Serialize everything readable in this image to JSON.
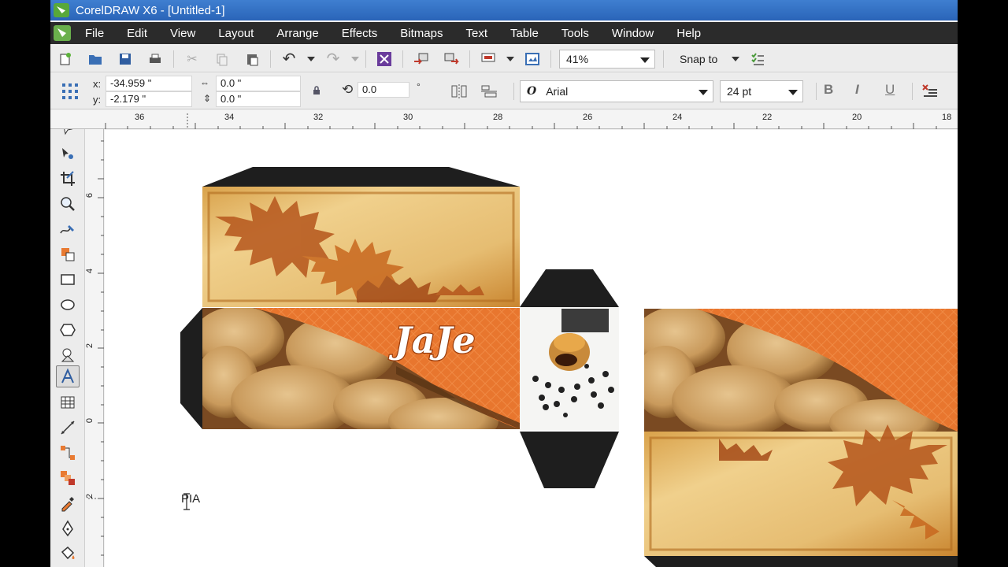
{
  "window": {
    "title": "CorelDRAW X6 - [Untitled-1]"
  },
  "menu": [
    "File",
    "Edit",
    "View",
    "Layout",
    "Arrange",
    "Effects",
    "Bitmaps",
    "Text",
    "Table",
    "Tools",
    "Window",
    "Help"
  ],
  "toolbar": {
    "zoom": "41%",
    "snap_label": "Snap to"
  },
  "property_bar": {
    "x_label": "x:",
    "x_value": "-34.959 \"",
    "y_label": "y:",
    "y_value": "-2.179 \"",
    "width_value": "0.0 \"",
    "height_value": "0.0 \"",
    "rotation_value": "0.0",
    "rotation_unit": "°",
    "font_name": "Arial",
    "font_size": "24 pt",
    "bold_label": "B",
    "italic_label": "I",
    "underline_label": "U"
  },
  "rulers": {
    "top": [
      "36",
      "34",
      "32",
      "30",
      "28",
      "26",
      "24",
      "22",
      "20",
      "18"
    ],
    "left": [
      "6",
      "4",
      "2",
      "0",
      "2"
    ]
  },
  "canvas": {
    "logo_text": "JaJe",
    "text_cursor_label": "PIA"
  },
  "colors": {
    "titlebar": "#2a64b8",
    "menubar": "#2b2b2b",
    "panel_black": "#1e1e1e",
    "orange": "#e87a32",
    "parchment": "#e6b86a"
  }
}
